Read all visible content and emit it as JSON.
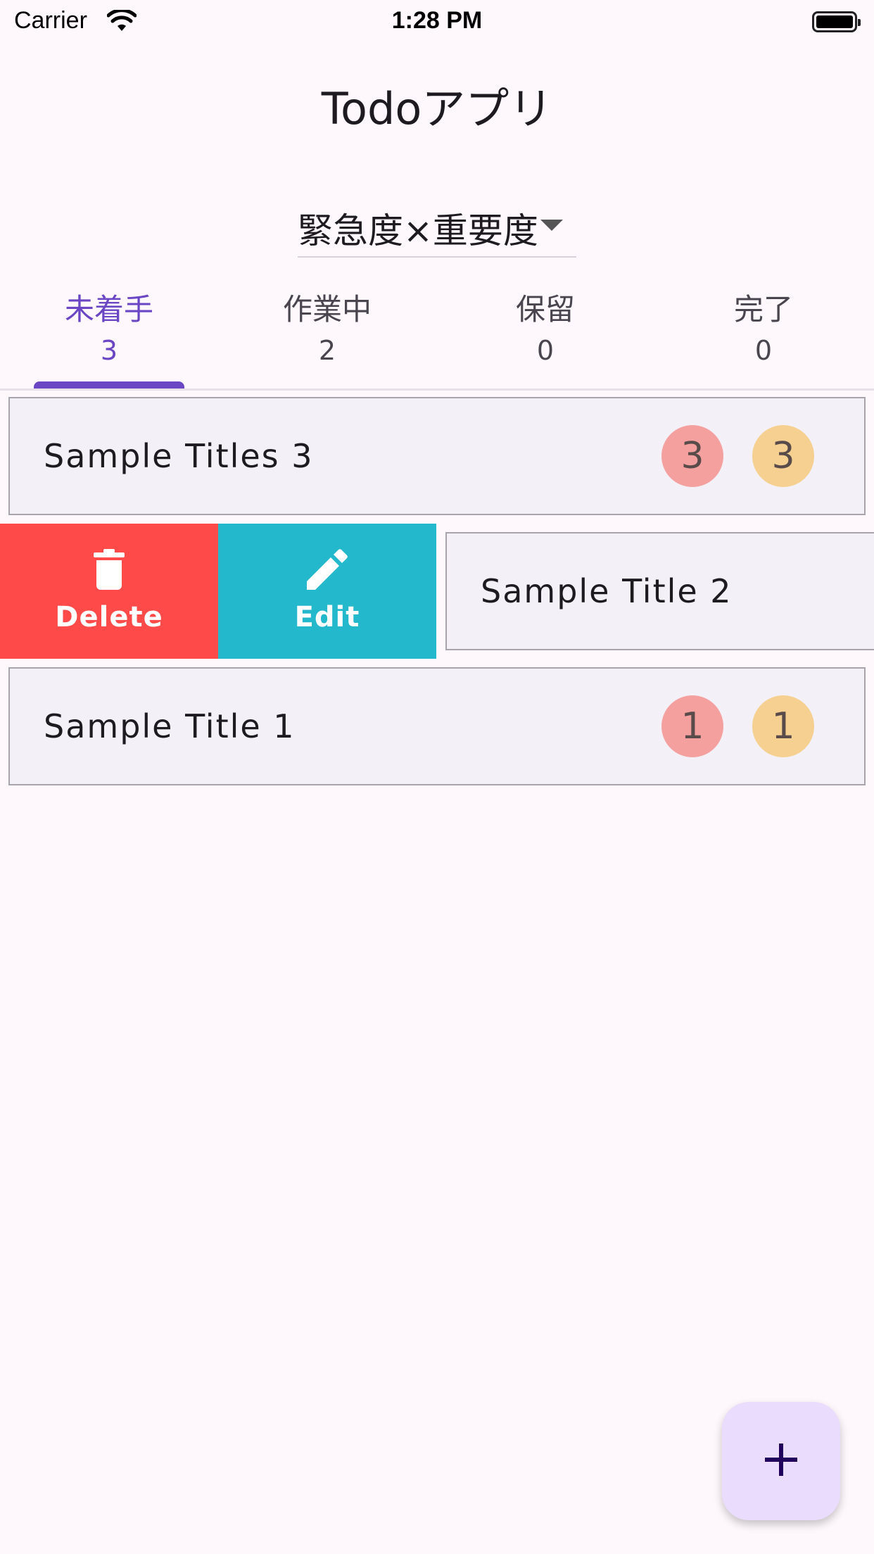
{
  "status_bar": {
    "carrier": "Carrier",
    "time": "1:28 PM"
  },
  "app": {
    "title": "Todoアプリ"
  },
  "sort_dropdown": {
    "selected": "緊急度×重要度"
  },
  "tabs": [
    {
      "label": "未着手",
      "count": "3",
      "active": true
    },
    {
      "label": "作業中",
      "count": "2",
      "active": false
    },
    {
      "label": "保留",
      "count": "0",
      "active": false
    },
    {
      "label": "完了",
      "count": "0",
      "active": false
    }
  ],
  "todos": [
    {
      "title": "Sample Titles 3",
      "urgency": "3",
      "importance": "3"
    },
    {
      "title": "Sample Title 2"
    },
    {
      "title": "Sample Title 1",
      "urgency": "1",
      "importance": "1"
    }
  ],
  "swipe_actions": {
    "delete_label": "Delete",
    "edit_label": "Edit"
  },
  "colors": {
    "accent": "#6a46c4",
    "delete": "#fe4a49",
    "edit": "#23b8cb",
    "urgency_badge": "#f4a09f",
    "importance_badge": "#f5d090",
    "fab": "#eadcfd"
  },
  "icons": {
    "delete": "trash-icon",
    "edit": "pencil-icon",
    "fab": "plus-icon"
  }
}
